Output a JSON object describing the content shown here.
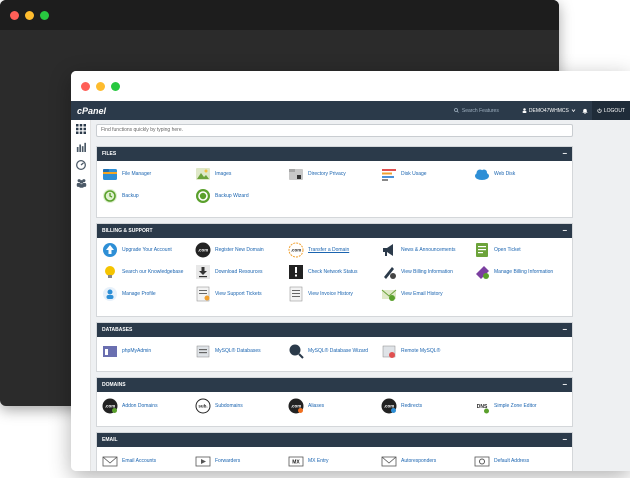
{
  "top_bar": {
    "logo": "cPanel",
    "search_placeholder": "Search Features",
    "user": "DEMO47WHMCS",
    "logout": "LOGOUT"
  },
  "search": {
    "placeholder": "Find functions quickly by typing here."
  },
  "sidebar": {
    "items": [
      "grid-icon",
      "stats-icon",
      "dashboard-icon",
      "users-icon"
    ]
  },
  "panels": [
    {
      "title": "FILES",
      "items": [
        "File Manager",
        "Images",
        "Directory Privacy",
        "Disk Usage",
        "Web Disk",
        "Backup",
        "Backup Wizard"
      ]
    },
    {
      "title": "BILLING & SUPPORT",
      "items": [
        "Upgrade Your Account",
        "Register New Domain",
        "Transfer a Domain",
        "News & Announcements",
        "Open Ticket",
        "Search our Knowledgebase",
        "Download Resources",
        "Check Network Status",
        "View Billing Information",
        "Manage Billing Information",
        "Manage Profile",
        "View Support Tickets",
        "View Invoice History",
        "View Email History"
      ]
    },
    {
      "title": "DATABASES",
      "items": [
        "phpMyAdmin",
        "MySQL® Databases",
        "MySQL® Database Wizard",
        "Remote MySQL®"
      ]
    },
    {
      "title": "DOMAINS",
      "items": [
        "Addon Domains",
        "Subdomains",
        "Aliases",
        "Redirects",
        "Simple Zone Editor"
      ]
    },
    {
      "title": "EMAIL",
      "items": [
        "Email Accounts",
        "Forwarders",
        "MX Entry",
        "Autoresponders",
        "Default Address"
      ]
    }
  ],
  "icon_text": {
    "com": ".com",
    "sub": "sub.",
    "dns": "DNS",
    "mx": "MX"
  },
  "colors": {
    "header": "#2b3a4a",
    "link": "#1a64b0",
    "background": "#eef0f2"
  }
}
